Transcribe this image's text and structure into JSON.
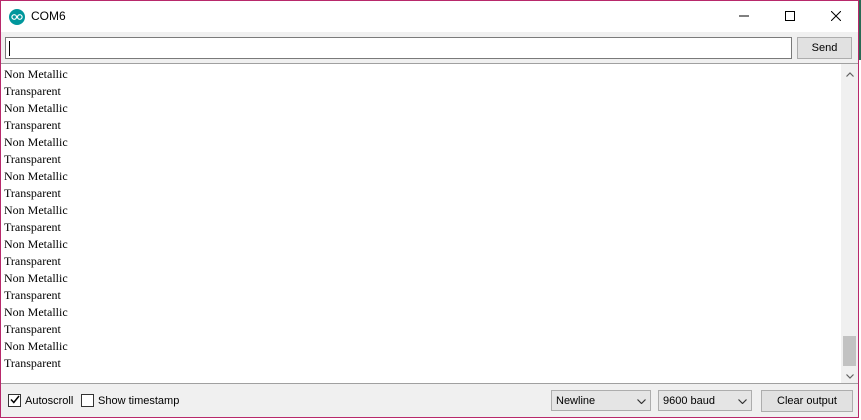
{
  "window": {
    "title": "COM6",
    "accent_color": "#b8296b"
  },
  "input": {
    "value": "",
    "send_label": "Send"
  },
  "output": {
    "lines": [
      "Non Metallic",
      "Transparent",
      "Non Metallic",
      "Transparent",
      "Non Metallic",
      "Transparent",
      "Non Metallic",
      "Transparent",
      "Non Metallic",
      "Transparent",
      "Non Metallic",
      "Transparent",
      "Non Metallic",
      "Transparent",
      "Non Metallic",
      "Transparent",
      "Non Metallic",
      "Transparent"
    ]
  },
  "footer": {
    "autoscroll_label": "Autoscroll",
    "autoscroll_checked": true,
    "timestamp_label": "Show timestamp",
    "timestamp_checked": false,
    "line_ending": "Newline",
    "baud_rate": "9600 baud",
    "clear_label": "Clear output"
  }
}
